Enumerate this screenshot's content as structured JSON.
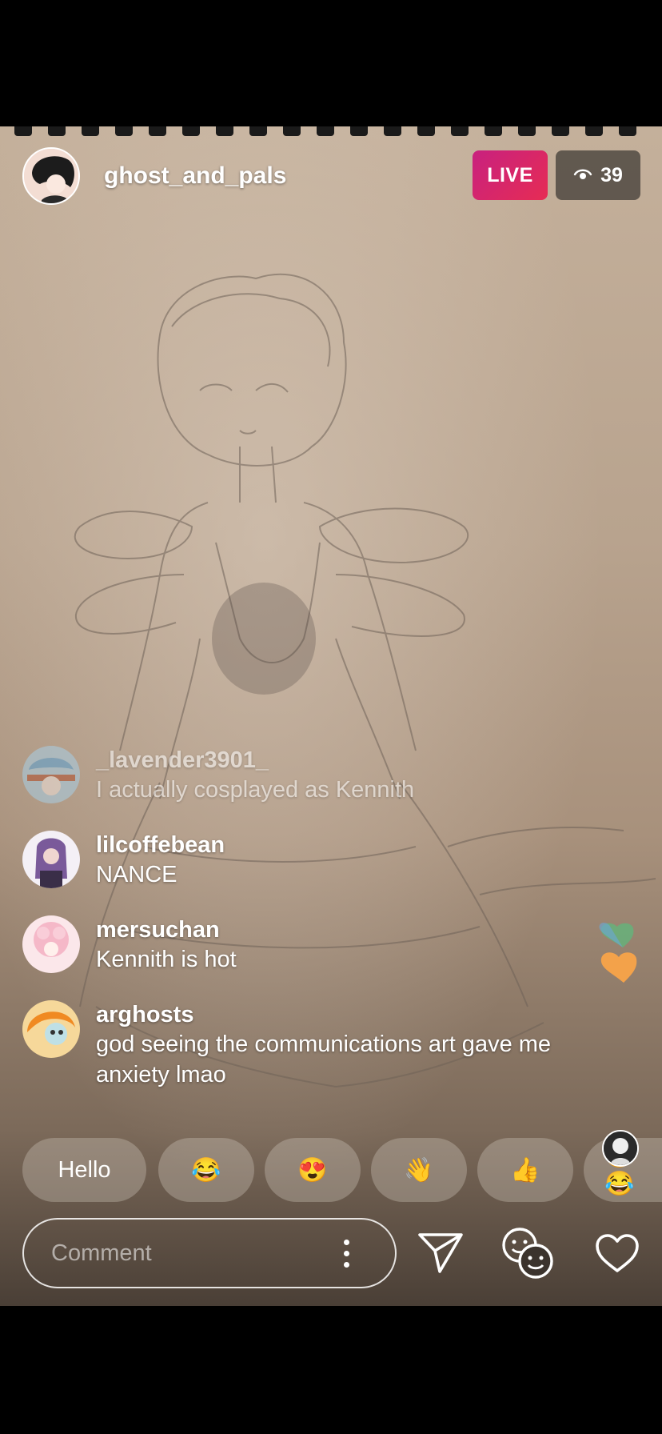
{
  "stream": {
    "host_name": "ghost_and_pals",
    "live_label": "LIVE",
    "viewer_count": "39"
  },
  "comments": [
    {
      "user": "_lavender3901_",
      "message": "I actually cosplayed as Kennith",
      "avatar_color": "#9fc4de"
    },
    {
      "user": "lilcoffebean",
      "message": "NANCE",
      "avatar_color": "#4a3a5c"
    },
    {
      "user": "mersuchan",
      "message": "Kennith is hot",
      "avatar_color": "#f6cfd8"
    },
    {
      "user": "arghosts",
      "message": "god seeing the communications art gave me anxiety lmao",
      "avatar_color": "#f0a030"
    }
  ],
  "quick_replies": [
    {
      "label": "Hello"
    },
    {
      "label": "😂"
    },
    {
      "label": "😍"
    },
    {
      "label": "👋"
    },
    {
      "label": "👍"
    },
    {
      "label": "😂😂"
    }
  ],
  "composer": {
    "placeholder": "Comment"
  },
  "icons": {
    "viewers": "eye-icon",
    "more": "kebab-menu-icon",
    "send": "paper-plane-icon",
    "effects": "face-filters-icon",
    "like": "heart-icon"
  },
  "colors": {
    "live_badge": "#d8246a",
    "floating_heart_green": "#66b27a",
    "floating_heart_orange": "#f3a24a"
  }
}
